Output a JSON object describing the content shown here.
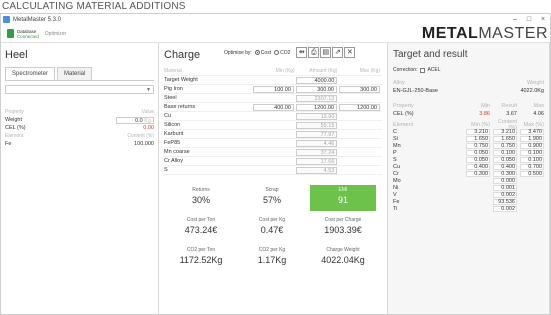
{
  "caption": "CALCULATING MATERIAL ADDITIONS",
  "window": {
    "title": "MetalMaster 5.3.0",
    "controls": [
      "–",
      "□",
      "×"
    ]
  },
  "toolbar": {
    "db_label": "Database",
    "db_status": "Connected",
    "optimizer_label": "Optimizer",
    "logo_bold": "METAL",
    "logo_rest": "MASTER"
  },
  "heel": {
    "title": "Heel",
    "tabs": [
      "Spectrometer",
      "Material"
    ],
    "prop_header": "Property",
    "value_header": "Value",
    "weight_label": "Weight",
    "weight_value": "0.0",
    "weight_unit": "Kg",
    "cel_label": "CEL (%)",
    "cel_value": "0.00",
    "elem_header": "Element",
    "content_header": "Content (%)",
    "fe_label": "Fe",
    "fe_value": "100.000"
  },
  "charge": {
    "title": "Charge",
    "optimize_label": "Optimise by:",
    "opt_cost": "Cost",
    "opt_co2": "CO2",
    "headers": {
      "material": "Material",
      "min": "Min (Kg)",
      "amount": "Amount (Kg)",
      "max": "Max (Kg)"
    },
    "rows": [
      {
        "name": "Target Weight",
        "min": "",
        "amount": "4000.00",
        "max": ""
      },
      {
        "name": "Pig Iron",
        "min": "100.00",
        "amount": "300.00",
        "max": "300.00"
      },
      {
        "name": "Steel",
        "min": "",
        "amount": "2307.13",
        "max": ""
      },
      {
        "name": "Base returns",
        "min": "400.00",
        "amount": "1200.00",
        "max": "1200.00"
      },
      {
        "name": "Cu",
        "min": "",
        "amount": "13.90",
        "max": ""
      },
      {
        "name": "Silicon",
        "min": "",
        "amount": "59.15",
        "max": ""
      },
      {
        "name": "Karburit",
        "min": "",
        "amount": "77.97",
        "max": ""
      },
      {
        "name": "FeP85",
        "min": "",
        "amount": "4.46",
        "max": ""
      },
      {
        "name": "Mn coarse",
        "min": "",
        "amount": "37.24",
        "max": ""
      },
      {
        "name": "Cr Alloy",
        "min": "",
        "amount": "17.66",
        "max": ""
      },
      {
        "name": "S",
        "min": "",
        "amount": "4.53",
        "max": ""
      }
    ],
    "stats": [
      {
        "label": "Returns",
        "value": "30%"
      },
      {
        "label": "Scrap",
        "value": "57%"
      },
      {
        "label": "EMI",
        "value": "91"
      },
      {
        "label": "Cost per Ton",
        "value": "473.24€"
      },
      {
        "label": "Cost per Kg",
        "value": "0.47€"
      },
      {
        "label": "Cost per Charge",
        "value": "1903.39€"
      },
      {
        "label": "CO2 per Ton",
        "value": "1172.52Kg"
      },
      {
        "label": "CO2 per Kg",
        "value": "1.17Kg"
      },
      {
        "label": "Charge Weight",
        "value": "4022.04Kg"
      }
    ]
  },
  "target": {
    "title": "Target and result",
    "correction_label": "Correction:",
    "acel_label": "ACEL",
    "alloy_header": "Alloy",
    "weight_header": "Weight",
    "alloy_name": "EN-GJL-250-Base",
    "alloy_weight": "4022.0Kg",
    "prop_headers": {
      "property": "Property",
      "min": "Min",
      "result": "Result",
      "max": "Max"
    },
    "cel": {
      "label": "CEL (%)",
      "min": "3.86",
      "result": "3.67",
      "max": "4.06"
    },
    "elem_headers": {
      "element": "Element",
      "min": "Min (%)",
      "content": "Content (%)",
      "max": "Max (%)"
    },
    "elements": [
      {
        "el": "C",
        "min": "3.210",
        "content": "3.210",
        "max": "3.470"
      },
      {
        "el": "Si",
        "min": "1.650",
        "content": "1.650",
        "max": "1.900"
      },
      {
        "el": "Mn",
        "min": "0.750",
        "content": "0.750",
        "max": "0.900"
      },
      {
        "el": "P",
        "min": "0.050",
        "content": "0.100",
        "max": "0.100"
      },
      {
        "el": "S",
        "min": "0.050",
        "content": "0.050",
        "max": "0.100"
      },
      {
        "el": "Cu",
        "min": "0.400",
        "content": "0.400",
        "max": "0.700"
      },
      {
        "el": "Cr",
        "min": "0.300",
        "content": "0.300",
        "max": "0.500"
      },
      {
        "el": "Mo",
        "min": "",
        "content": "0.000",
        "max": ""
      },
      {
        "el": "Ni",
        "min": "",
        "content": "0.001",
        "max": ""
      },
      {
        "el": "V",
        "min": "",
        "content": "0.002",
        "max": ""
      },
      {
        "el": "Fe",
        "min": "",
        "content": "93.536",
        "max": ""
      },
      {
        "el": "Ti",
        "min": "",
        "content": "0.002",
        "max": ""
      }
    ]
  }
}
